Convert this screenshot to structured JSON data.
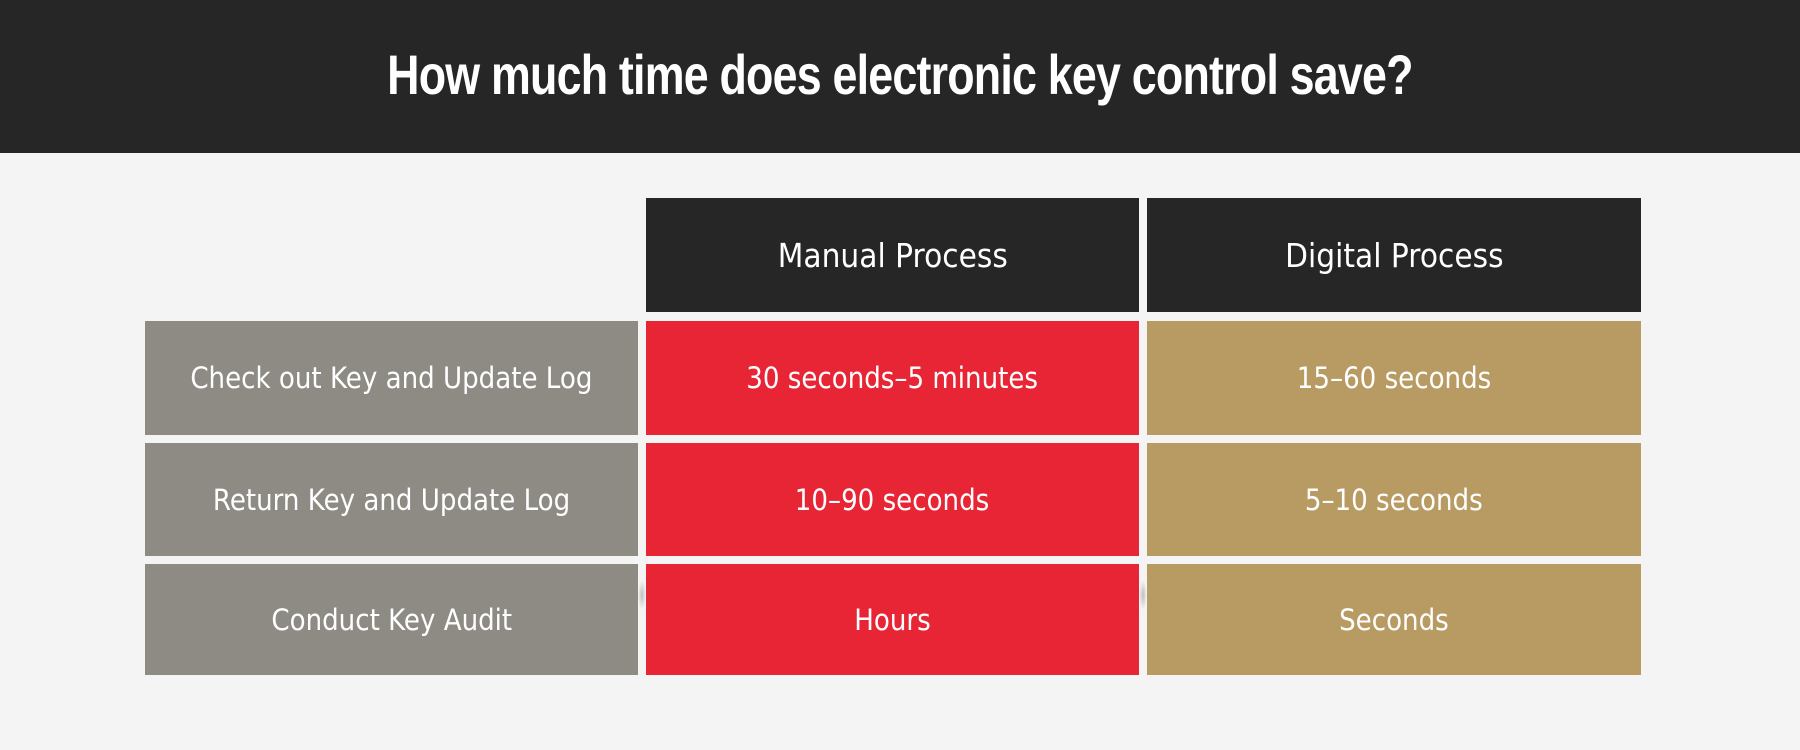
{
  "title": "How much time does electronic key control save?",
  "columns": {
    "manual": "Manual Process",
    "digital": "Digital Process"
  },
  "rows": [
    {
      "label": "Check out Key and Update Log",
      "manual": "30 seconds–5 minutes",
      "digital": "15–60 seconds"
    },
    {
      "label": "Return Key and Update Log",
      "manual": "10–90 seconds",
      "digital": "5–10 seconds"
    },
    {
      "label": "Conduct Key Audit",
      "manual": "Hours",
      "digital": "Seconds"
    }
  ],
  "colors": {
    "background": "#f4f4f4",
    "header": "#262626",
    "label_cell": "#8e8b85",
    "manual_cell": "#e72535",
    "digital_cell": "#b89b62",
    "text": "#ffffff"
  }
}
